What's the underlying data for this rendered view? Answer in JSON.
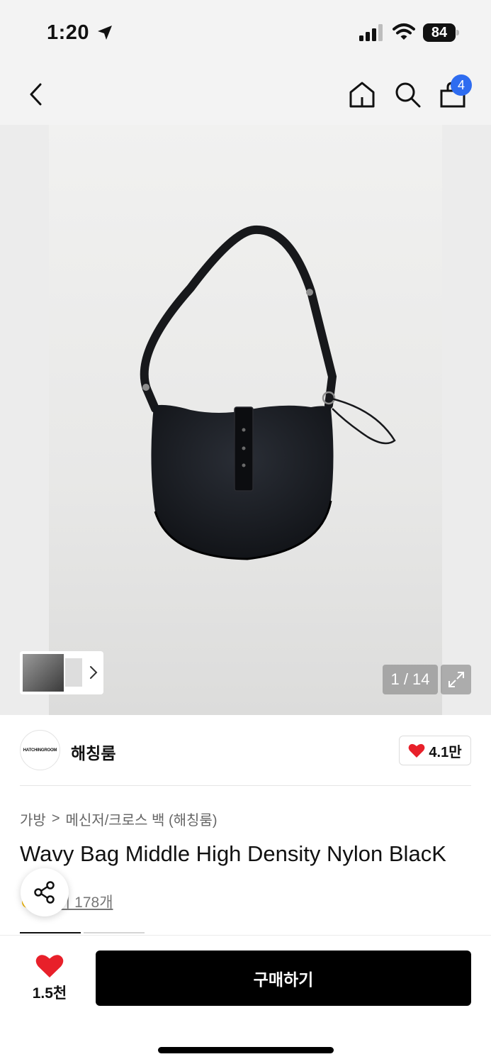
{
  "status_bar": {
    "time": "1:20",
    "battery": "84"
  },
  "nav": {
    "cart_count": "4"
  },
  "gallery": {
    "counter": "1 / 14"
  },
  "brand": {
    "logo_text": "HATCHINGROOM",
    "name": "해칭룸",
    "likes": "4.1만"
  },
  "breadcrumb": {
    "category": "가방",
    "separator": ">",
    "subcategory": "메신저/크로스 백 (해칭룸)"
  },
  "product": {
    "title": "Wavy Bag Middle High Density Nylon BlacK",
    "reviews": "후기 178개",
    "reviews_visible": "기 178개"
  },
  "bottom": {
    "wish_count": "1.5천",
    "buy_label": "구매하기"
  },
  "colors": {
    "accent": "#2e6cf0",
    "heart": "#e8202a",
    "buy_bg": "#000000"
  }
}
